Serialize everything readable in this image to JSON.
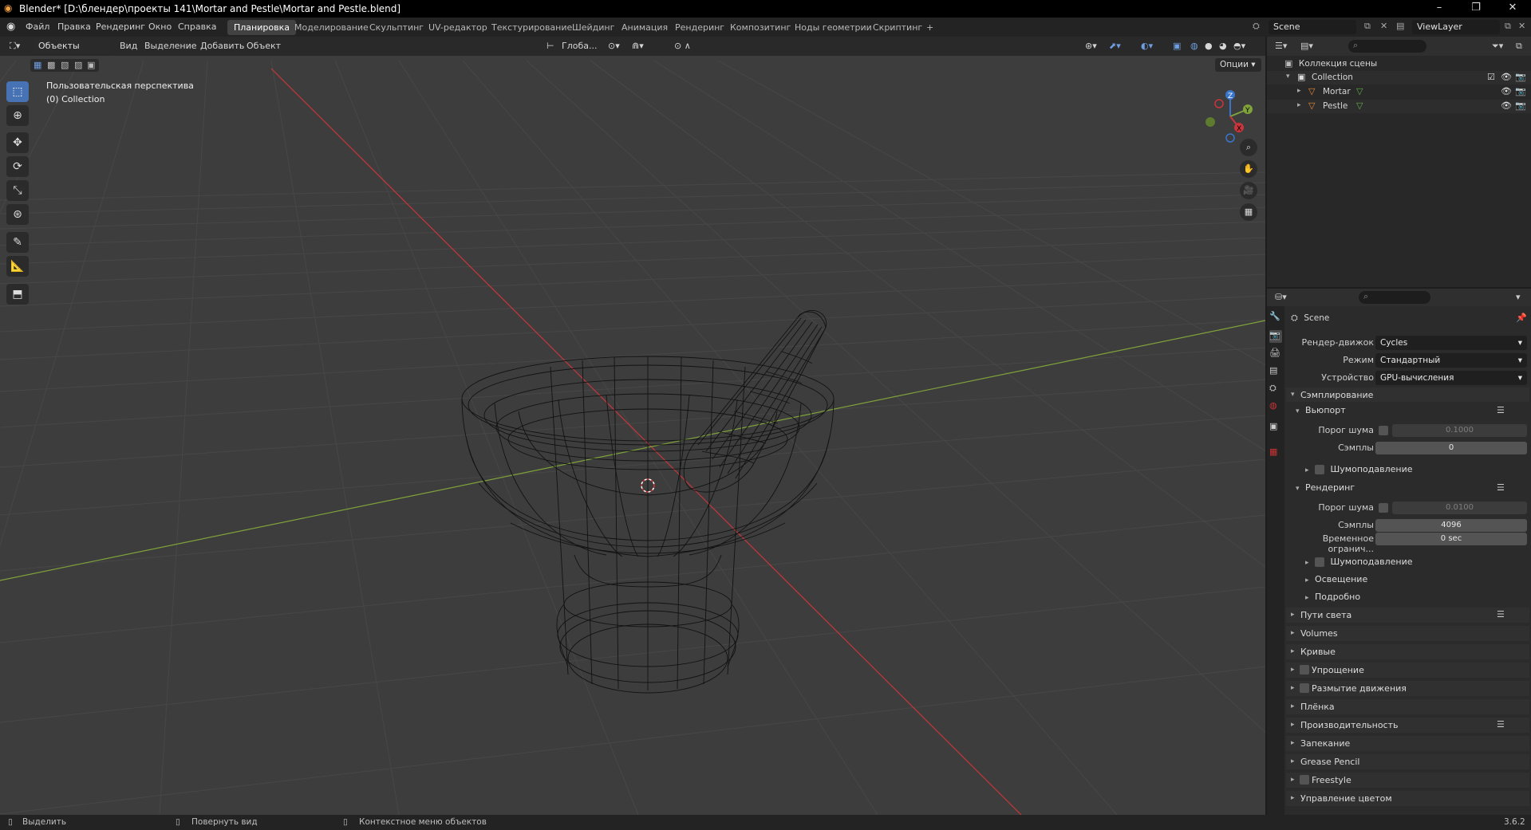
{
  "window": {
    "title": "Blender* [D:\\блендер\\проекты 141\\Mortar and Pestle\\Mortar and Pestle.blend]",
    "minimize": "–",
    "maximize": "❐",
    "close": "✕"
  },
  "menu": [
    "Файл",
    "Правка",
    "Рендеринг",
    "Окно",
    "Справка"
  ],
  "workspaces": [
    "Планировка",
    "Моделирование",
    "Скульптинг",
    "UV-редактор",
    "Текстурирование",
    "Шейдинг",
    "Анимация",
    "Рендеринг",
    "Композитинг",
    "Ноды геометрии",
    "Скриптинг"
  ],
  "add_workspace": "+",
  "scene_name": "Scene",
  "view_layer": "ViewLayer",
  "viewport": {
    "mode": "Объекты",
    "menus": [
      "Вид",
      "Выделение",
      "Добавить",
      "Объект"
    ],
    "orientation": "Глоба...",
    "options": "Опции",
    "view_name": "Пользовательская перспектива",
    "collection_info": "(0) Collection",
    "gizmo_labels": {
      "x": "X",
      "y": "Y",
      "z": "Z"
    }
  },
  "outliner": {
    "root": "Коллекция сцены",
    "items": [
      {
        "label": "Collection",
        "level": 1
      },
      {
        "label": "Mortar",
        "level": 2
      },
      {
        "label": "Pestle",
        "level": 2
      }
    ]
  },
  "properties": {
    "context": "Scene",
    "render_engine_label": "Рендер-движок",
    "render_engine": "Cycles",
    "mode_label": "Режим",
    "mode": "Стандартный",
    "device_label": "Устройство",
    "device": "GPU-вычисления",
    "sampling": "Сэмплирование",
    "viewport_section": "Вьюпорт",
    "noise_threshold_label": "Порог шума",
    "viewport_noise": "0.1000",
    "samples_label": "Сэмплы",
    "viewport_samples": "0",
    "denoise": "Шумоподавление",
    "render_section": "Рендеринг",
    "render_noise": "0.0100",
    "render_samples": "4096",
    "time_limit_label": "Временное огранич...",
    "time_limit": "0 sec",
    "denoise2": "Шумоподавление",
    "lighting": "Освещение",
    "advanced": "Подробно",
    "panels": [
      "Пути света",
      "Volumes",
      "Кривые",
      "Упрощение",
      "Размытие движения",
      "Плёнка",
      "Производительность",
      "Запекание",
      "Grease Pencil",
      "Freestyle",
      "Управление цветом"
    ]
  },
  "status": {
    "select": "Выделить",
    "rotate": "Повернуть вид",
    "context_menu": "Контекстное меню объектов",
    "version": "3.6.2"
  },
  "colors": {
    "accent": "#4772b3",
    "x_axis": "#c8363c",
    "y_axis": "#7fa33a",
    "z_axis": "#3a75cc",
    "mesh_icon": "#e88a3a",
    "data_icon": "#5fb04a"
  }
}
